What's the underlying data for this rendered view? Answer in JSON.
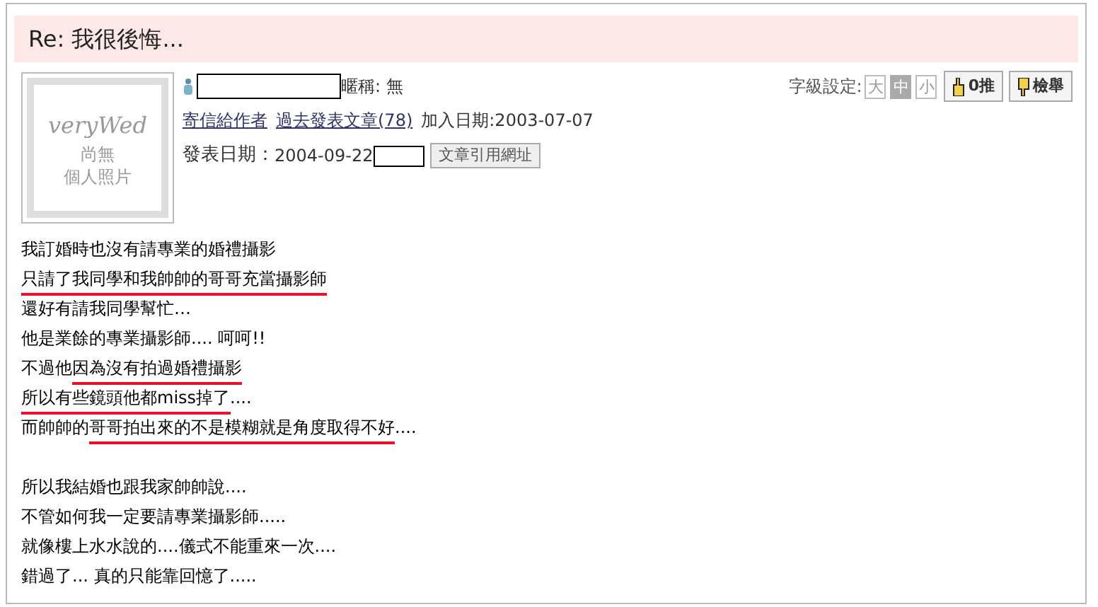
{
  "post": {
    "title": "Re: 我很後悔...",
    "avatar": {
      "logo": "veryWed",
      "caption_1": "尚無",
      "caption_2": "個人照片"
    },
    "nickname": "暱稱: 無",
    "links": [
      {
        "label": "寄信給作者"
      },
      {
        "label": "過去發表文章(78)"
      }
    ],
    "join_date": "加入日期:2003-07-07",
    "post_date_label": "發表日期：",
    "post_date": "2004-09-22",
    "quote_button": "文章引用網址",
    "font_size_label": "字級設定:",
    "font_sizes": [
      {
        "label": "大",
        "selected": false
      },
      {
        "label": "中",
        "selected": true
      },
      {
        "label": "小",
        "selected": false
      }
    ],
    "like_button": "0推",
    "report_button": "檢舉",
    "body": [
      [
        {
          "text": "我訂婚時也沒有請專業的婚禮攝影",
          "marked": false
        }
      ],
      [
        {
          "text": "只請了我同學和我帥帥的哥哥充當攝影師",
          "marked": true
        }
      ],
      [
        {
          "text": "還好有請我同學幫忙…",
          "marked": false
        }
      ],
      [
        {
          "text": "他是業餘的專業攝影師.... 呵呵!!",
          "marked": false
        }
      ],
      [
        {
          "text": "不過他",
          "marked": false
        },
        {
          "text": "因為沒有拍過婚禮攝影",
          "marked": true
        }
      ],
      [
        {
          "text": "所以有些鏡頭他都miss掉了",
          "marked": true
        },
        {
          "text": "....",
          "marked": false
        }
      ],
      [
        {
          "text": "而帥帥的",
          "marked": false
        },
        {
          "text": "哥哥拍出來的不是模糊就是角度取得不好",
          "marked": true
        },
        {
          "text": "....",
          "marked": false
        }
      ],
      [
        {
          "text": "所以我結婚也跟我家帥帥說....",
          "marked": false,
          "space_before": true
        }
      ],
      [
        {
          "text": "不管如何我一定要請專業攝影師.....",
          "marked": false
        }
      ],
      [
        {
          "text": "就像樓上水水說的....儀式不能重來一次....",
          "marked": false
        }
      ],
      [
        {
          "text": "錯過了... 真的只能靠回憶了.....",
          "marked": false
        }
      ]
    ]
  }
}
